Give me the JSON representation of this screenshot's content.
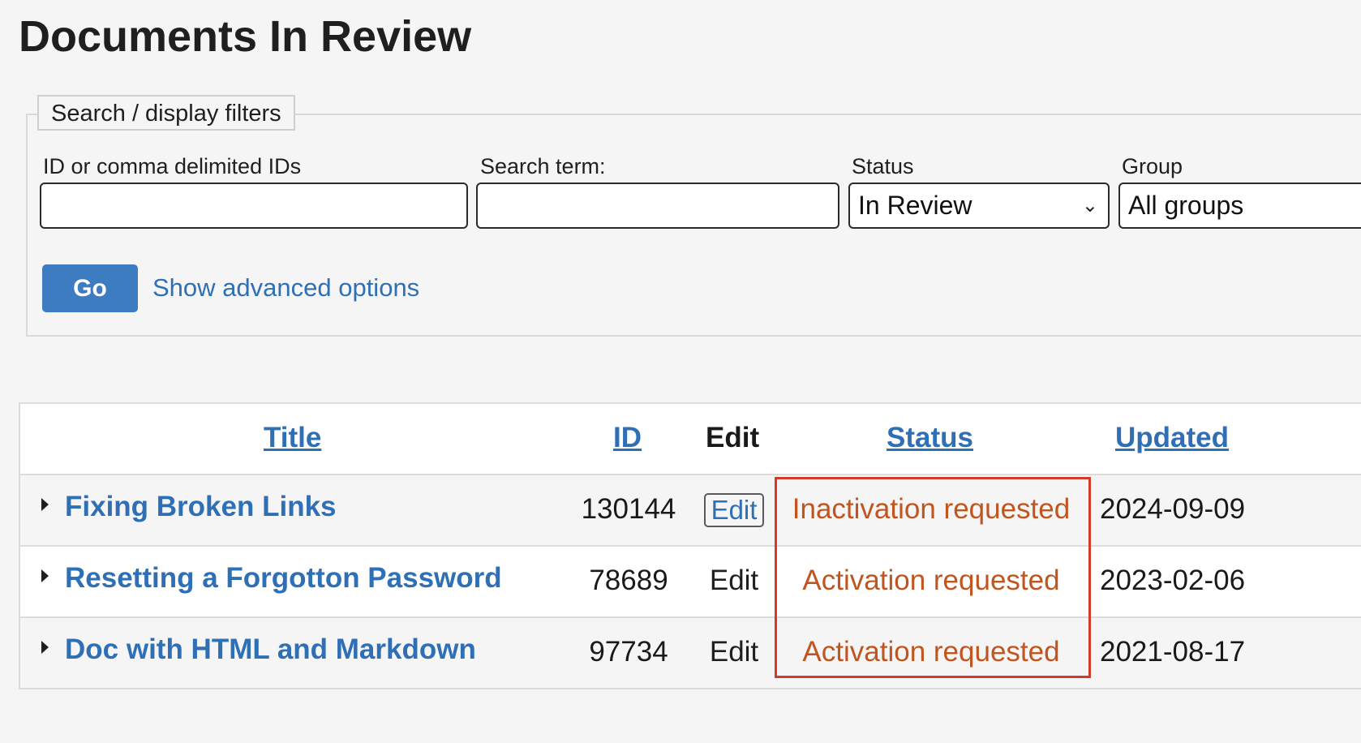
{
  "page": {
    "title": "Documents In Review"
  },
  "filters": {
    "legend": "Search / display filters",
    "ids_label": "ID or comma delimited IDs",
    "ids_value": "",
    "search_label": "Search term:",
    "search_value": "",
    "status_label": "Status",
    "status_selected": "In Review",
    "group_label": "Group",
    "group_selected": "All groups",
    "go_label": "Go",
    "advanced_link": "Show advanced options"
  },
  "table": {
    "columns": {
      "title": "Title",
      "id": "ID",
      "edit": "Edit",
      "status": "Status",
      "updated": "Updated"
    },
    "rows": [
      {
        "title": "Fixing Broken Links",
        "id": "130144",
        "edit": "Edit",
        "status": "Inactivation requested",
        "updated": "2024-09-09"
      },
      {
        "title": "Resetting a Forgotton Password",
        "id": "78689",
        "edit": "Edit",
        "status": "Activation requested",
        "updated": "2023-02-06"
      },
      {
        "title": "Doc with HTML and Markdown",
        "id": "97734",
        "edit": "Edit",
        "status": "Activation requested",
        "updated": "2021-08-17"
      }
    ]
  },
  "colors": {
    "link": "#2f6fb5",
    "status": "#c0551f",
    "highlight": "#d23b2b",
    "go_button": "#3d7cc1"
  }
}
